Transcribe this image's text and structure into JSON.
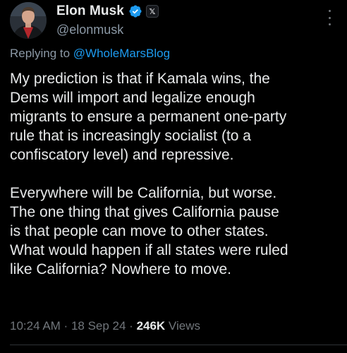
{
  "author": {
    "display_name": "Elon Musk",
    "handle": "@elonmusk",
    "verified_icon": "verified-badge-icon",
    "affiliation_badge": "𝕏"
  },
  "reply": {
    "prefix": "Replying to ",
    "mention": "@WholeMarsBlog"
  },
  "tweet": {
    "text": "My prediction is that if Kamala wins, the\nDems will import and legalize enough\nmigrants to ensure a permanent one-party\nrule that is increasingly socialist (to a\nconfiscatory level) and repressive.\n\nEverywhere will be California, but worse.\nThe one thing that gives California pause\nis that people can move to other states.\nWhat would happen if all states were ruled\nlike California? Nowhere to move."
  },
  "meta": {
    "time": "10:24 AM",
    "sep1": " · ",
    "date": "18 Sep 24",
    "sep2": " · ",
    "views_count": "246K",
    "views_label": " Views"
  },
  "colors": {
    "background": "#000000",
    "text": "#e7e9ea",
    "secondary": "#71767b",
    "accent": "#1d9bf0"
  }
}
